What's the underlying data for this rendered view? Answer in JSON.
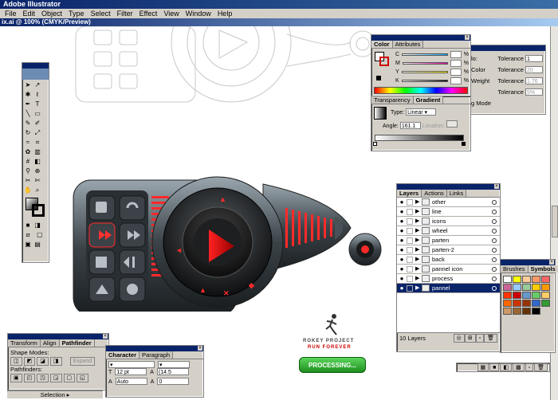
{
  "app": {
    "title": "Adobe Illustrator",
    "document_title": "ix.ai @ 100% (CMYK/Preview)"
  },
  "menu": [
    "File",
    "Edit",
    "Object",
    "Type",
    "Select",
    "Filter",
    "Effect",
    "View",
    "Window",
    "Help"
  ],
  "color_panel": {
    "tabs": [
      "Color",
      "Attributes"
    ],
    "channels": [
      {
        "label": "C",
        "unit": "%"
      },
      {
        "label": "M",
        "unit": "%"
      },
      {
        "label": "Y",
        "unit": "%"
      },
      {
        "label": "K",
        "unit": "%"
      }
    ]
  },
  "gradient_panel": {
    "tabs": [
      "Transparency",
      "Gradient"
    ],
    "type_label": "Type:",
    "type_value": "Linear",
    "angle_label": "Angle:",
    "angle_value": "161.1",
    "location_label": "Location:"
  },
  "tolerance_panel": {
    "rows": [
      {
        "label": "lo:",
        "tol_label": "Tolerance",
        "value": "1"
      },
      {
        "label": "Color",
        "tol_label": "Tolerance",
        "value": "20"
      },
      {
        "label": "Weight",
        "tol_label": "Tolerance",
        "value": "1.76"
      },
      {
        "label": "",
        "tol_label": "Tolerance",
        "value": "5%"
      }
    ],
    "mode_label": "g Mode"
  },
  "layers_panel": {
    "tabs": [
      "Layers",
      "Actions",
      "Links"
    ],
    "layers": [
      "other",
      "line",
      "icons",
      "wheel",
      "parten",
      "parten-2",
      "back",
      "pannel icon",
      "process",
      "pannel"
    ],
    "selected": "pannel",
    "count_label": "10 Layers"
  },
  "swatches_panel": {
    "tabs": [
      "Brushes",
      "Symbols"
    ],
    "colors": [
      "#ffffff",
      "#ffff00",
      "#ffcc99",
      "#ff9966",
      "#ff6666",
      "#cc6699",
      "#99ccff",
      "#99cc99",
      "#ffcc00",
      "#ff9900",
      "#ff3300",
      "#cc0000",
      "#6699cc",
      "#66cc66",
      "#ffcc66",
      "#ff6600",
      "#cc3300",
      "#993300",
      "#3366cc",
      "#339933",
      "#cc9966",
      "#996633",
      "#663300",
      "#000000"
    ]
  },
  "pathfinder_panel": {
    "tabs": [
      "Transform",
      "Align",
      "Pathfinder"
    ],
    "shape_modes_label": "Shape Modes:",
    "expand_label": "Expand",
    "pathfinders_label": "Pathfinders:"
  },
  "character_panel": {
    "tabs": [
      "Character",
      "Paragraph"
    ],
    "size_value": "12 pt",
    "leading_value": "(14.5",
    "kerning_value": "Auto",
    "tracking_value": "0"
  },
  "status": {
    "selection_label": "Selection"
  },
  "artwork": {
    "logo_line1": "ROKEY PROJECT",
    "logo_line2": "RUN FOREVER",
    "process_button": "PROCESSING..."
  }
}
